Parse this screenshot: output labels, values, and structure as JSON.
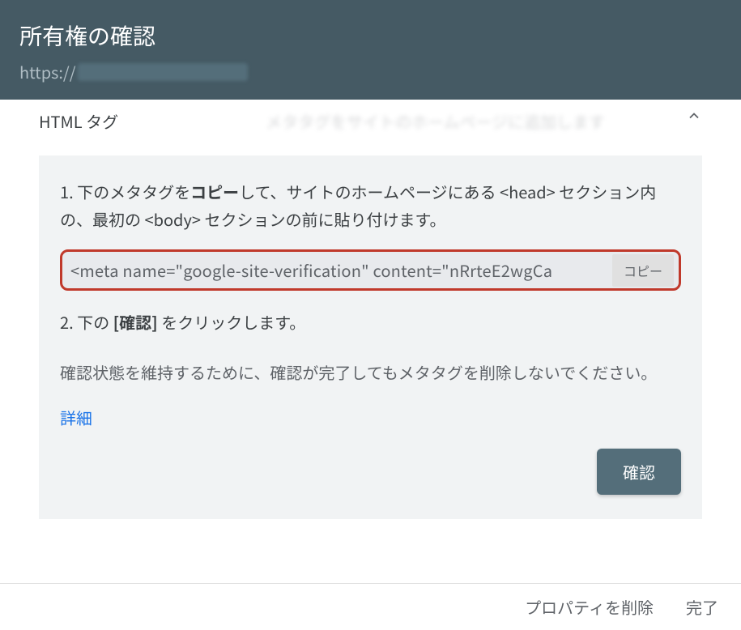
{
  "header": {
    "title": "所有権の確認",
    "url_prefix": "https://"
  },
  "section": {
    "label": "HTML タグ",
    "description_obscured": "メタタグをサイトのホームページに追加します"
  },
  "panel": {
    "step1_prefix": "1. 下のメタタグを",
    "step1_bold": "コピー",
    "step1_suffix": "して、サイトのホームページにある <head> セクション内の、最初の <body> セクションの前に貼り付けます。",
    "meta_tag": "<meta name=\"google-site-verification\" content=\"nRrteE2wgCa",
    "copy_label": "コピー",
    "step2_prefix": "2. 下の ",
    "step2_bold": "[確認]",
    "step2_suffix": " をクリックします。",
    "note": "確認状態を維持するために、確認が完了してもメタタグを削除しないでください。",
    "details_link": "詳細",
    "confirm_label": "確認"
  },
  "footer": {
    "remove_label": "プロパティを削除",
    "done_label": "完了"
  }
}
